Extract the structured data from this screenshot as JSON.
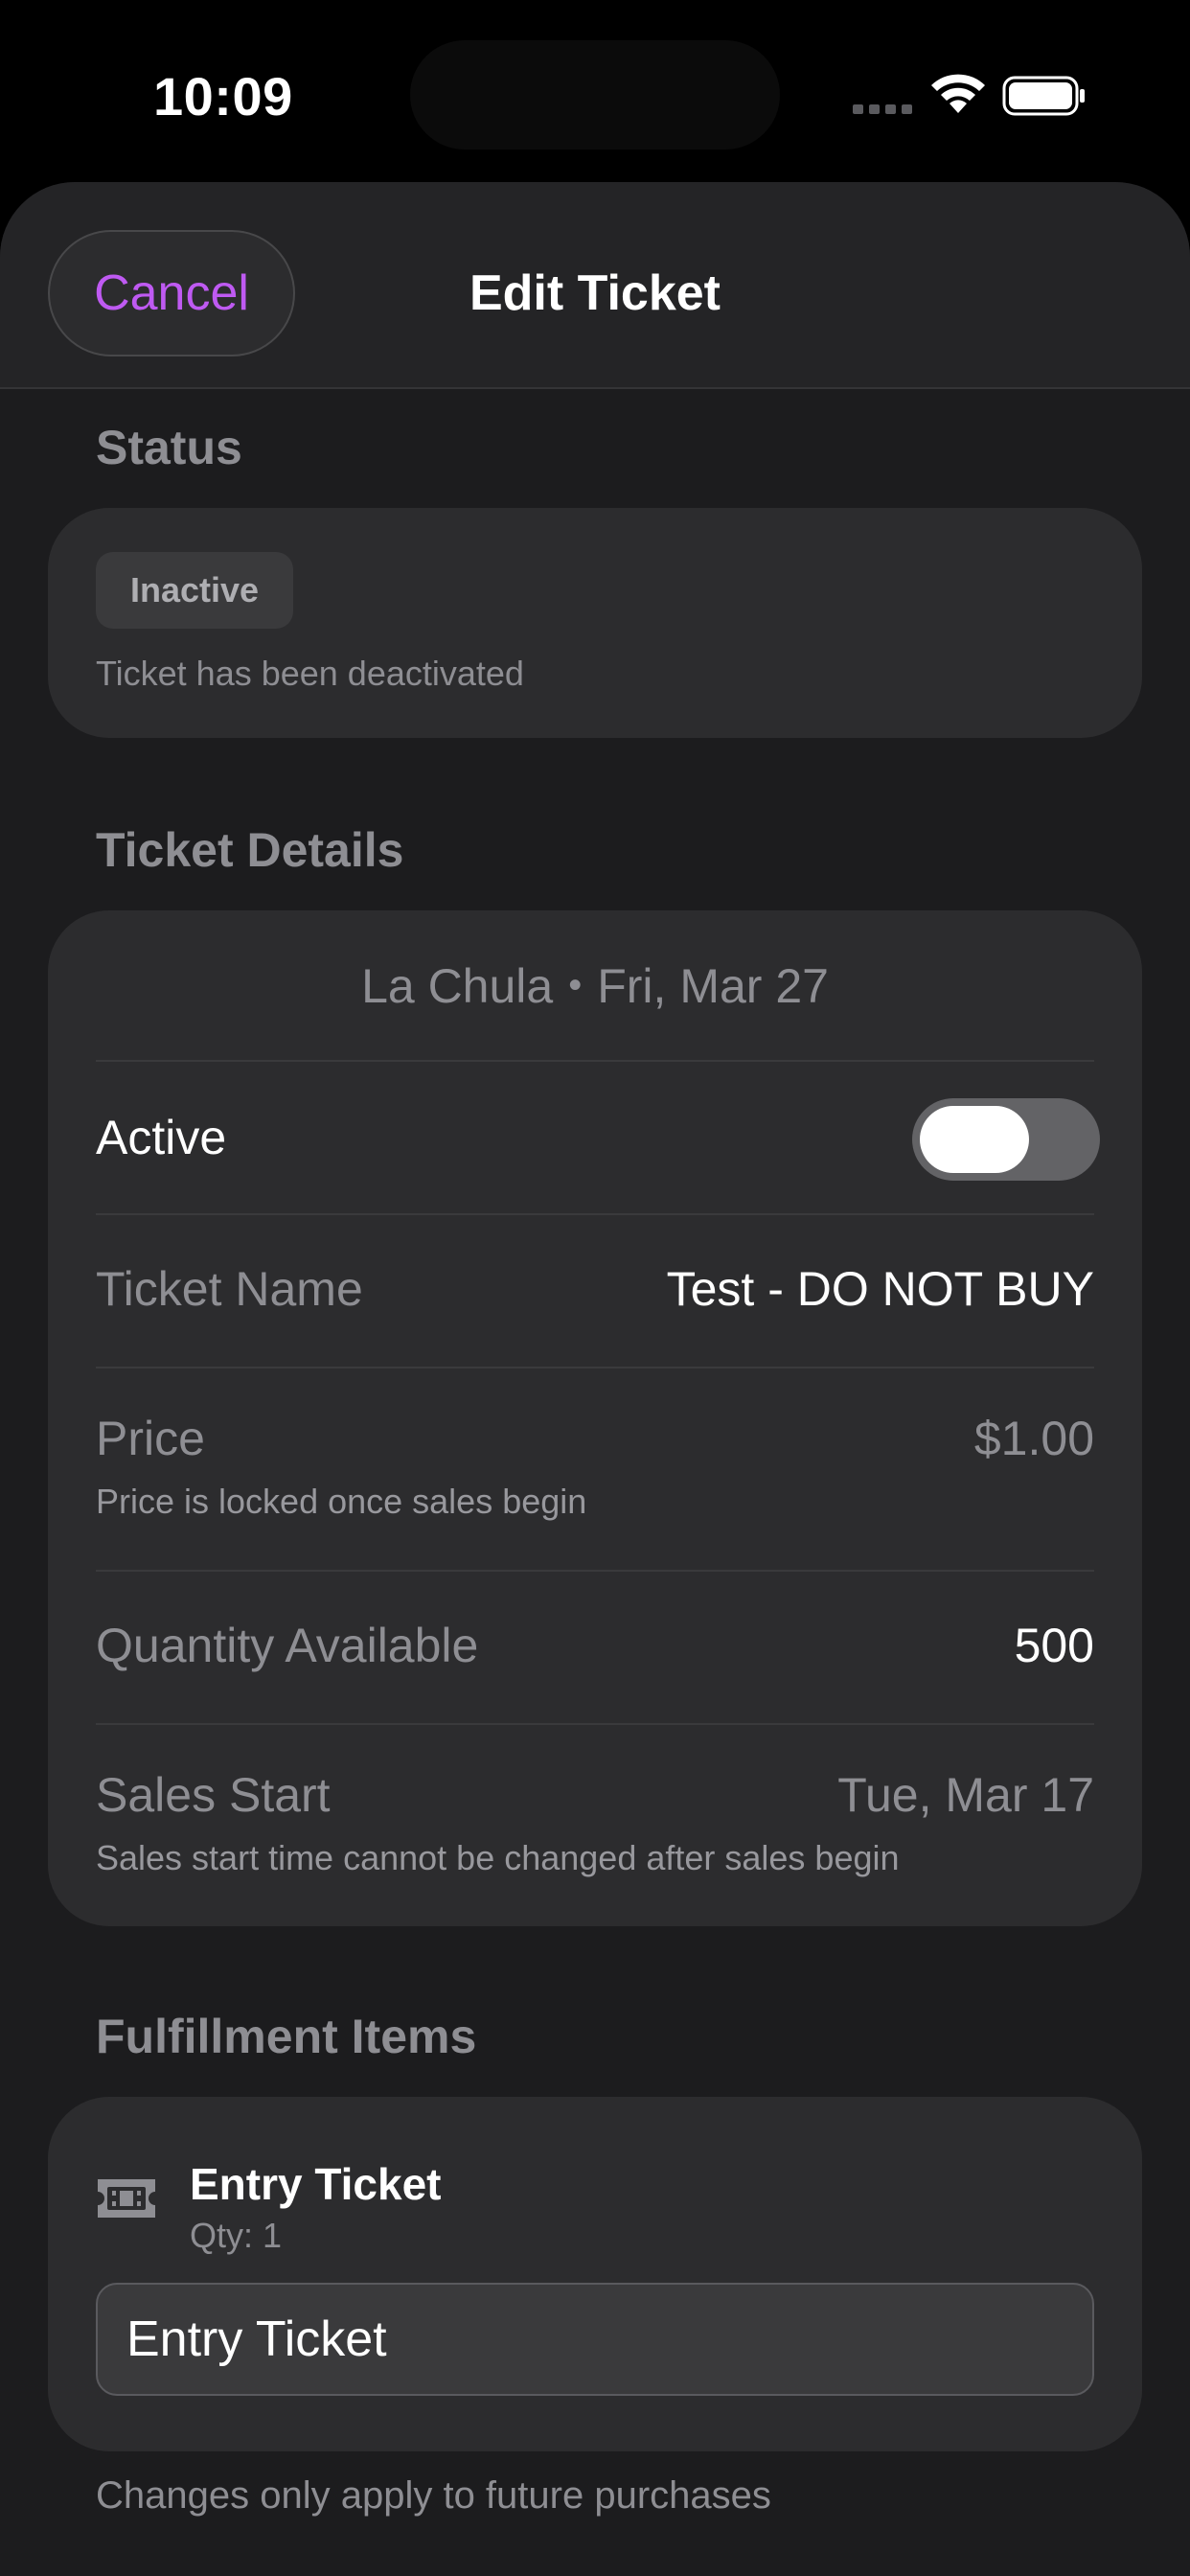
{
  "status_bar": {
    "time": "10:09",
    "icons": [
      "signal-icon",
      "wifi-icon",
      "battery-icon"
    ]
  },
  "nav": {
    "cancel_label": "Cancel",
    "title": "Edit Ticket"
  },
  "status_section": {
    "header": "Status",
    "badge": "Inactive",
    "description": "Ticket has been deactivated"
  },
  "details_section": {
    "header": "Ticket Details",
    "venue": "La Chula",
    "separator": "•",
    "date": "Fri, Mar 27",
    "active": {
      "label": "Active",
      "on": false
    },
    "ticket_name": {
      "label": "Ticket Name",
      "value": "Test - DO NOT BUY"
    },
    "price": {
      "label": "Price",
      "value": "$1.00",
      "note": "Price is locked once sales begin"
    },
    "quantity": {
      "label": "Quantity Available",
      "value": "500"
    },
    "sales_start": {
      "label": "Sales Start",
      "value": "Tue, Mar 17",
      "note": "Sales start time cannot be changed after sales begin"
    }
  },
  "fulfillment_section": {
    "header": "Fulfillment Items",
    "item": {
      "icon": "ticket-icon",
      "name": "Entry Ticket",
      "qty": "Qty: 1",
      "input_value": "Entry Ticket"
    },
    "footer_note": "Changes only apply to future purchases"
  },
  "colors": {
    "accent": "#bf5af2",
    "background": "#1c1c1e",
    "card": "#2c2c2e",
    "secondary_text": "#8e8e93"
  }
}
